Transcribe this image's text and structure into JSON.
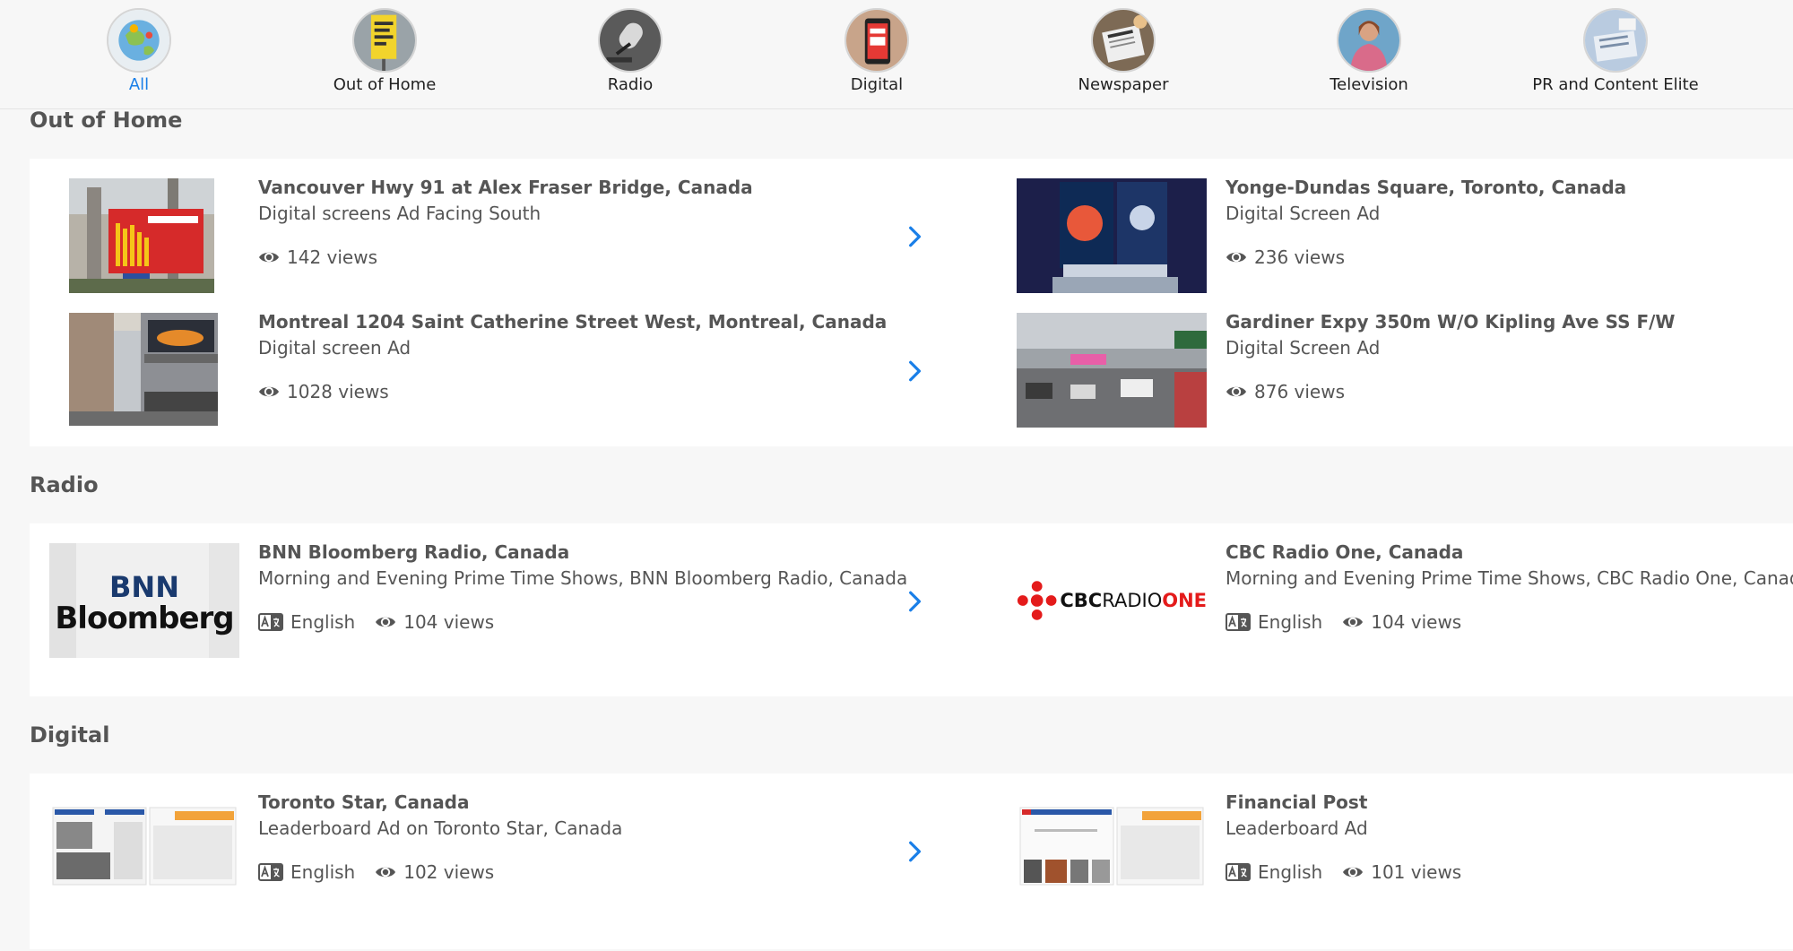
{
  "categories": [
    {
      "label": "All",
      "active": true
    },
    {
      "label": "Out of Home"
    },
    {
      "label": "Radio"
    },
    {
      "label": "Digital"
    },
    {
      "label": "Newspaper"
    },
    {
      "label": "Television"
    },
    {
      "label": "PR and Content Elite"
    }
  ],
  "colors": {
    "accent": "#1a7fe8",
    "text": "#555555",
    "card": "#ffffff",
    "page": "#f7f7f7"
  },
  "sections": [
    {
      "title": "Out of Home",
      "items": [
        {
          "title": "Vancouver Hwy 91 at Alex Fraser Bridge, Canada",
          "subtitle": "Digital screens Ad Facing South",
          "views": "142 views"
        },
        {
          "title": "Yonge-Dundas Square, Toronto, Canada",
          "subtitle": "Digital Screen Ad",
          "views": "236 views"
        },
        {
          "title": "Montreal 1204 Saint Catherine Street West, Montreal, Canada",
          "subtitle": "Digital screen Ad",
          "views": "1028 views"
        },
        {
          "title": "Gardiner Expy 350m W/O Kipling Ave SS F/W",
          "subtitle": "Digital Screen Ad",
          "views": "876 views"
        }
      ]
    },
    {
      "title": "Radio",
      "items": [
        {
          "title": "BNN Bloomberg Radio, Canada",
          "subtitle": "Morning and Evening Prime Time Shows, BNN Bloomberg Radio, Canada",
          "language": "English",
          "views": "104 views",
          "logo_line1": "BNN",
          "logo_line2": "Bloomberg"
        },
        {
          "title": "CBC Radio One, Canada",
          "subtitle": "Morning and Evening Prime Time Shows, CBC Radio One, Canada",
          "language": "English",
          "views": "104 views",
          "logo_a": "CBC",
          "logo_b": "RADIO",
          "logo_c": "ONE"
        }
      ]
    },
    {
      "title": "Digital",
      "items": [
        {
          "title": "Toronto Star, Canada",
          "subtitle": "Leaderboard Ad on Toronto Star, Canada",
          "language": "English",
          "views": "102 views"
        },
        {
          "title": "Financial Post",
          "subtitle": "Leaderboard Ad",
          "language": "English",
          "views": "101 views"
        }
      ]
    }
  ]
}
